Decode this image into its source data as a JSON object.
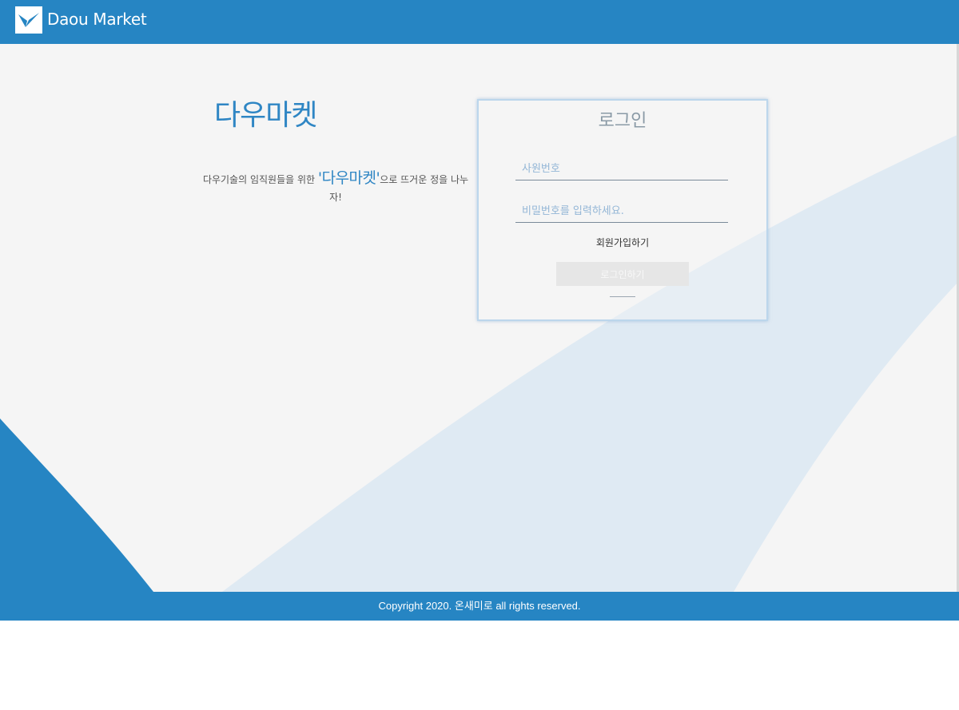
{
  "header": {
    "brand_name": "Daou Market",
    "logo_icon": "check-wings-logo-icon"
  },
  "hero": {
    "title": "다우마켓",
    "description_prefix": "다우기술의 임직원들을 위한 ",
    "description_highlight": "'다우마켓'",
    "description_suffix": "으로 뜨거운 정을 나누자!"
  },
  "login": {
    "title": "로그인",
    "employee_id": {
      "value": "",
      "placeholder": "사원번호"
    },
    "password": {
      "value": "",
      "placeholder": "비밀번호를 입력하세요."
    },
    "signup_label": "회원가입하기",
    "submit_label": "로그인하기"
  },
  "footer": {
    "copyright": "Copyright 2020. 온새미로 all rights reserved."
  },
  "colors": {
    "brand_blue": "#2685c3",
    "title_blue": "#2f86c4",
    "page_background": "#f5f5f5",
    "wave_light": "#dfeaf3",
    "button_disabled": "#e6e6e6"
  }
}
